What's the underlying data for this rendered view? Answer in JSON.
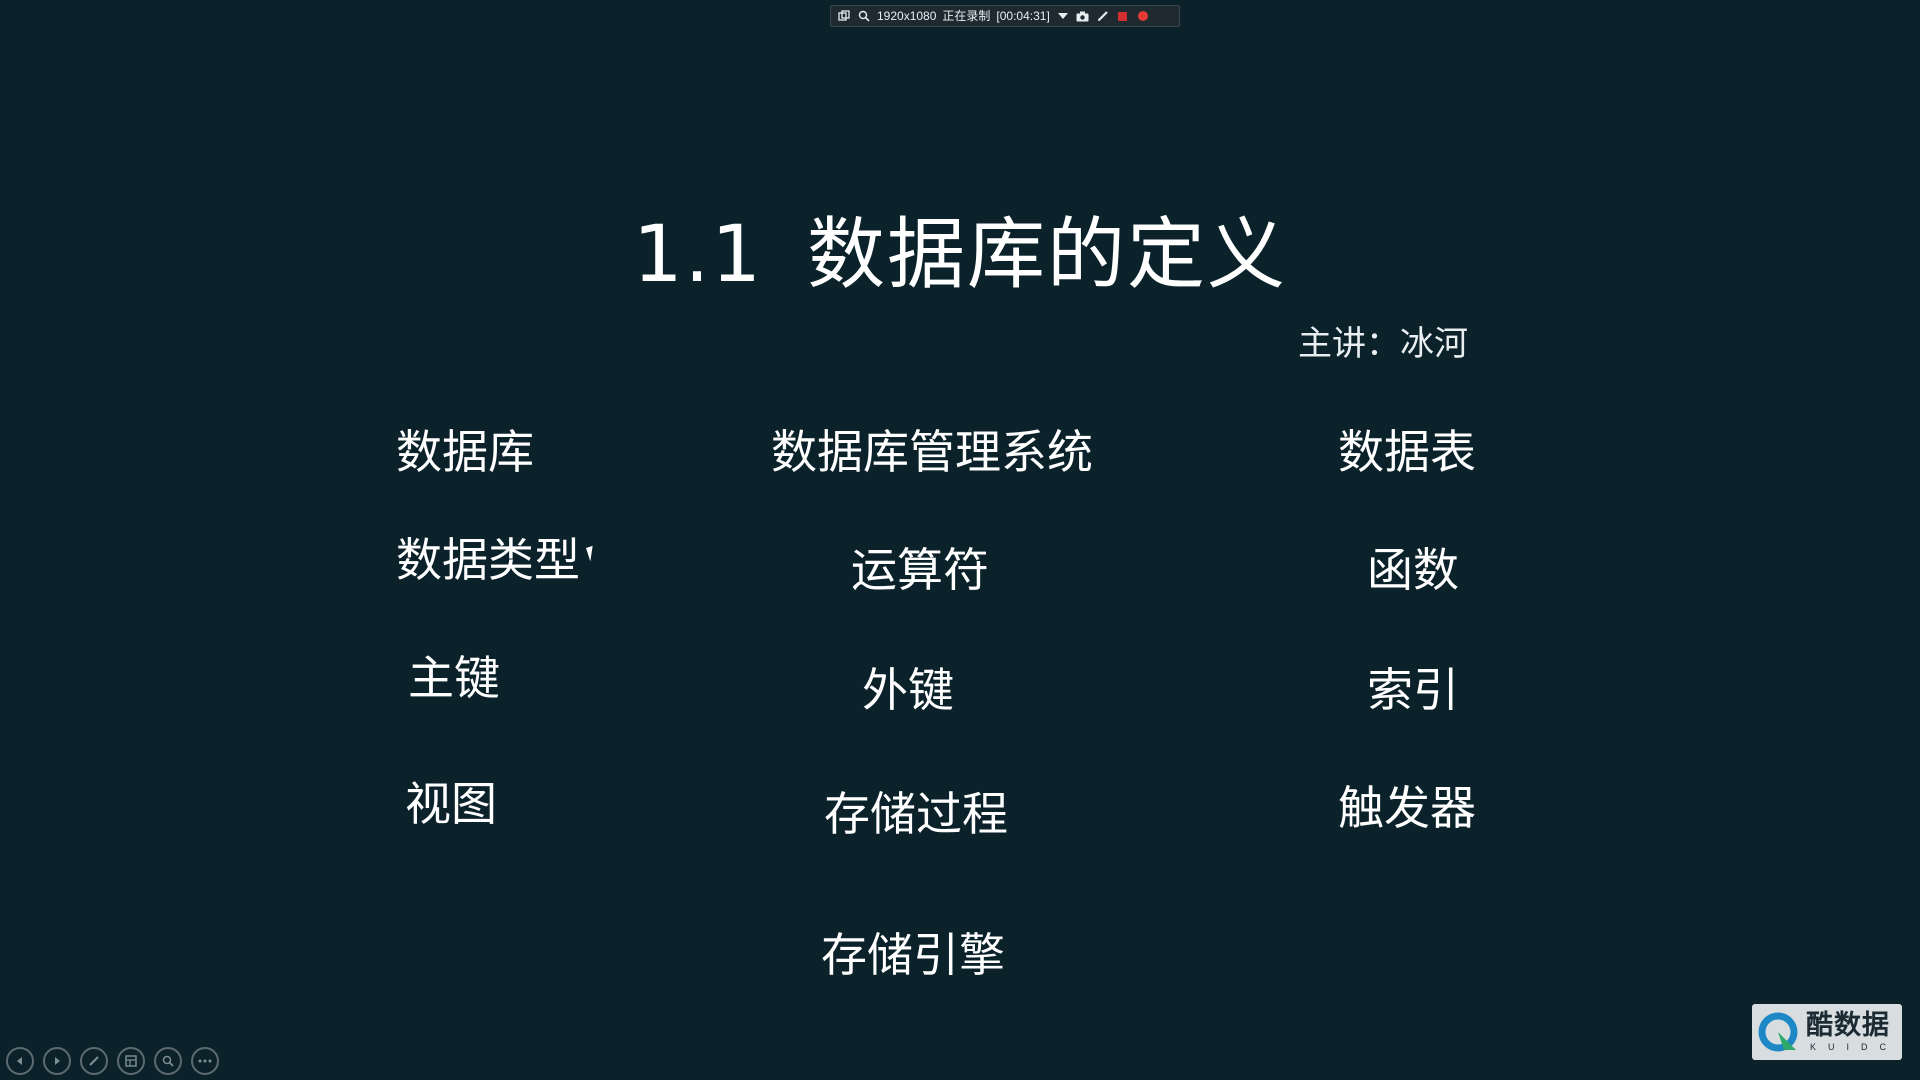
{
  "recorder": {
    "resolution": "1920x1080",
    "status": "正在录制",
    "elapsed": "[00:04:31]"
  },
  "slide": {
    "title_number": "1.1",
    "title_text": "数据库的定义",
    "presenter": "主讲：冰河"
  },
  "terms": {
    "col1": [
      "数据库",
      "数据类型",
      "主键",
      "视图"
    ],
    "col2": [
      "数据库管理系统",
      "运算符",
      "外键",
      "存储过程",
      "存储引擎"
    ],
    "col3": [
      "数据表",
      "函数",
      "索引",
      "触发器"
    ]
  },
  "controls": [
    "previous-slide-icon",
    "next-slide-icon",
    "pen-icon",
    "slides-icon",
    "zoom-icon",
    "more-icon"
  ],
  "watermark": {
    "name": "酷数据",
    "letters": "KUIDC"
  },
  "colors": {
    "background": "#0b222b",
    "text": "#ffffff",
    "record": "#d32f2f"
  }
}
